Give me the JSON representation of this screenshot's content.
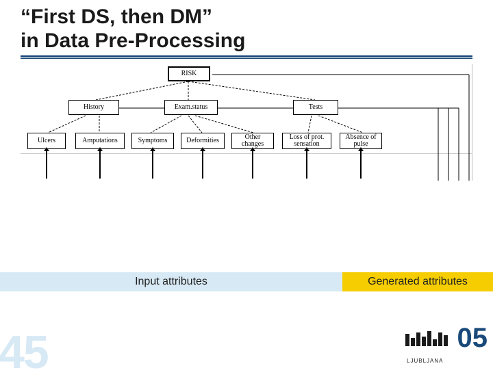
{
  "title_line1": "“First DS, then DM”",
  "title_line2": "in Data Pre-Processing",
  "tree": {
    "root": "RISK",
    "level1": [
      "History",
      "Exam.status",
      "Tests"
    ],
    "level2": [
      "Ulcers",
      "Amputations",
      "Symptoms",
      "Deformities",
      "Other changes",
      "Loss of prot. sensation",
      "Absence of pulse"
    ]
  },
  "legend": {
    "input": "Input attributes",
    "generated": "Generated attributes"
  },
  "slide_number": "45",
  "logo": {
    "year_suffix": "05",
    "city": "LJUBLJANA"
  }
}
